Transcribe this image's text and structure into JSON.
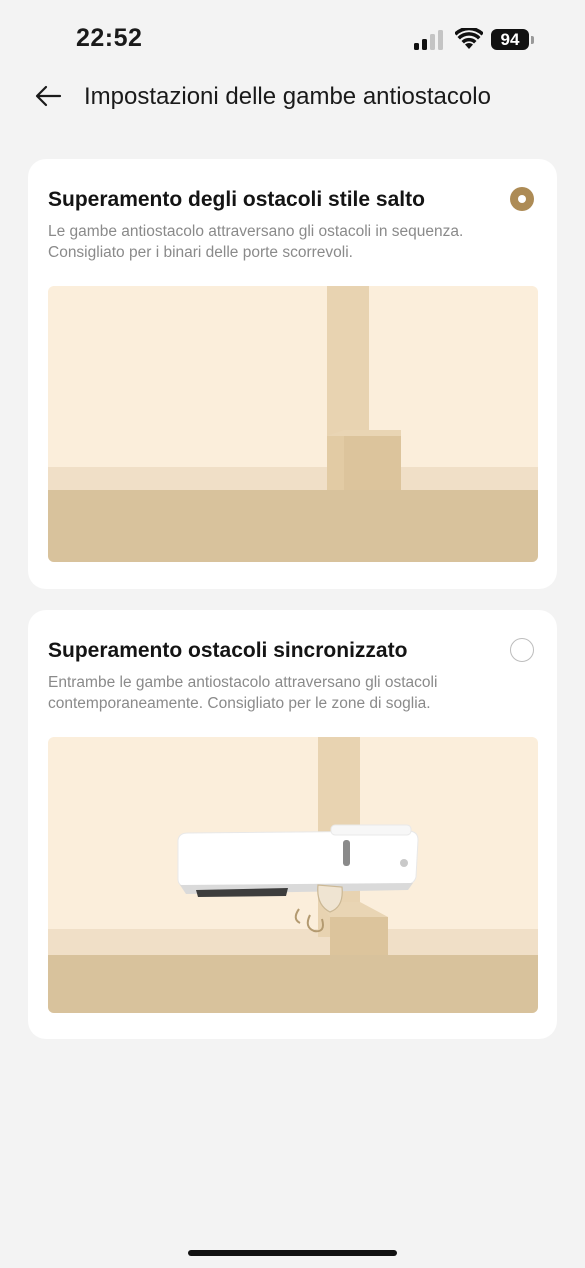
{
  "status_bar": {
    "time": "22:52",
    "battery": "94",
    "icons": [
      "signal-icon",
      "wifi-icon",
      "battery-icon"
    ]
  },
  "header": {
    "title": "Impostazioni delle gambe antiostacolo",
    "back_icon": "arrow-left-icon"
  },
  "options": [
    {
      "title": "Superamento degli ostacoli stile salto",
      "description": "Le gambe antiostacolo attraversano gli ostacoli in sequenza. Consigliato per i binari delle porte scorrevoli.",
      "selected": true
    },
    {
      "title": "Superamento ostacoli sincronizzato",
      "description": "Entrambe le gambe antiostacolo attraversano gli ostacoli contemporaneamente. Consigliato per le zone di soglia.",
      "selected": false
    }
  ],
  "colors": {
    "accent": "#ad8b55",
    "illustration_bg": "#fbeedb",
    "floor": "#d8c29c",
    "floor_strip": "#f0dfc7",
    "pillar": "#e8d3b1"
  }
}
